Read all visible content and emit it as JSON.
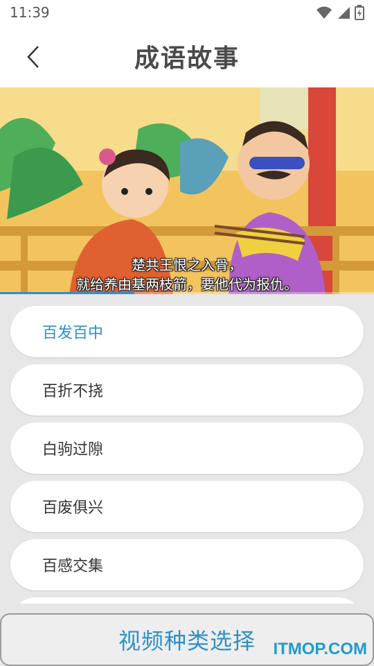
{
  "status_bar": {
    "time": "11:39"
  },
  "header": {
    "title": "成语故事"
  },
  "video": {
    "subtitle_line1": "楚共王恨之入骨，",
    "subtitle_line2": "就给养由基两枝箭，要他代为报仇。",
    "progress": 0.36
  },
  "idioms": [
    {
      "label": "百发百中",
      "active": true
    },
    {
      "label": "百折不挠",
      "active": false
    },
    {
      "label": "白驹过隙",
      "active": false
    },
    {
      "label": "百废俱兴",
      "active": false
    },
    {
      "label": "百感交集",
      "active": false
    }
  ],
  "bottom_bar": {
    "label": "视频种类选择"
  },
  "watermark": {
    "text": "ITMOP.COM"
  },
  "colors": {
    "accent": "#2e90c8",
    "watermark": "#1f9bd1"
  },
  "icons": [
    "wifi-icon",
    "signal-icon",
    "battery-icon",
    "back-arrow-icon"
  ]
}
